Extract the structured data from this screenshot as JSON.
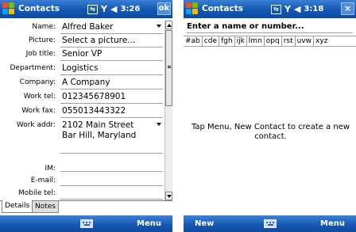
{
  "left_screen": {
    "title": "Contacts",
    "tray": {
      "time": "3:26",
      "ok_label": "ok",
      "keyboard_label": "⊞"
    },
    "fields": [
      {
        "label": "Name:",
        "value": "Alfred Baker",
        "dropdown": true
      },
      {
        "label": "Picture:",
        "value": "Select a picture..."
      },
      {
        "label": "Job title:",
        "value": "Senior VP"
      },
      {
        "label": "Department:",
        "value": "Logistics"
      },
      {
        "label": "Company:",
        "value": "A Company"
      },
      {
        "label": "Work tel:",
        "value": "012345678901"
      },
      {
        "label": "Work fax:",
        "value": "055013443322"
      },
      {
        "label": "Work addr:",
        "value": "2102 Main Street",
        "value2": "Bar Hill, Maryland",
        "dropdown": true
      },
      {
        "label": "IM:",
        "value": ""
      },
      {
        "label": "E-mail:",
        "value": ""
      },
      {
        "label": "Mobile tel:",
        "value": ""
      }
    ],
    "tabs": [
      "Details",
      "Notes"
    ],
    "menubar": {
      "left": "",
      "right": "Menu"
    }
  },
  "right_screen": {
    "title": "Contacts",
    "tray": {
      "time": "3:18",
      "close_label": "×"
    },
    "search_placeholder": "Enter a name or number...",
    "alpha_tabs": [
      "#ab",
      "cde",
      "fgh",
      "ijk",
      "lmn",
      "opq",
      "rst",
      "uvw",
      "xyz"
    ],
    "empty_message": "Tap Menu, New Contact to create a new contact.",
    "menubar": {
      "left": "New",
      "right": "Menu"
    }
  },
  "colors": {
    "titlebar": "#1258b4",
    "menubar": "#1456b0",
    "field_line": "#9aa0a8"
  },
  "icons": [
    "windows-start-icon",
    "connectivity-icon",
    "signal-icon",
    "volume-icon",
    "keyboard-icon"
  ]
}
